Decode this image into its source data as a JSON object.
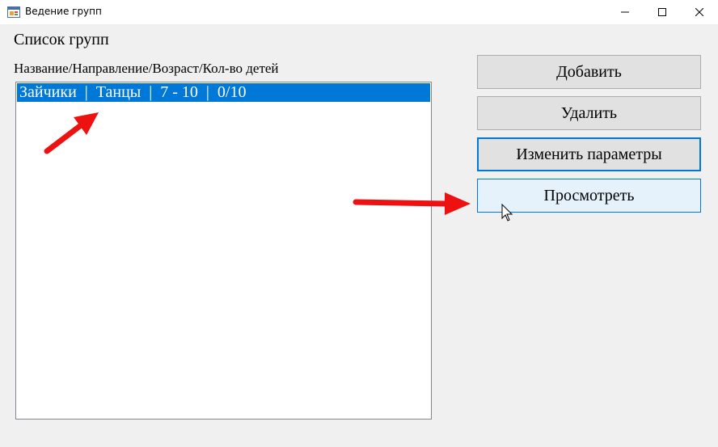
{
  "window": {
    "title": "Ведение групп",
    "icon": "app-icon",
    "controls": [
      "minimize-icon",
      "maximize-icon",
      "close-icon"
    ]
  },
  "main": {
    "list_title": "Список групп",
    "columns_header": "Название/Направление/Возраст/Кол-во детей",
    "groups": [
      {
        "text": "Зайчики  |  Танцы  |  7 - 10  |  0/10",
        "selected": true
      }
    ]
  },
  "actions": {
    "add_label": "Добавить",
    "delete_label": "Удалить",
    "edit_label": "Изменить параметры",
    "view_label": "Просмотреть"
  },
  "colors": {
    "selection": "#0078d7",
    "annotation_arrow": "#ee1111",
    "hover_button": "#e5f1fb"
  }
}
